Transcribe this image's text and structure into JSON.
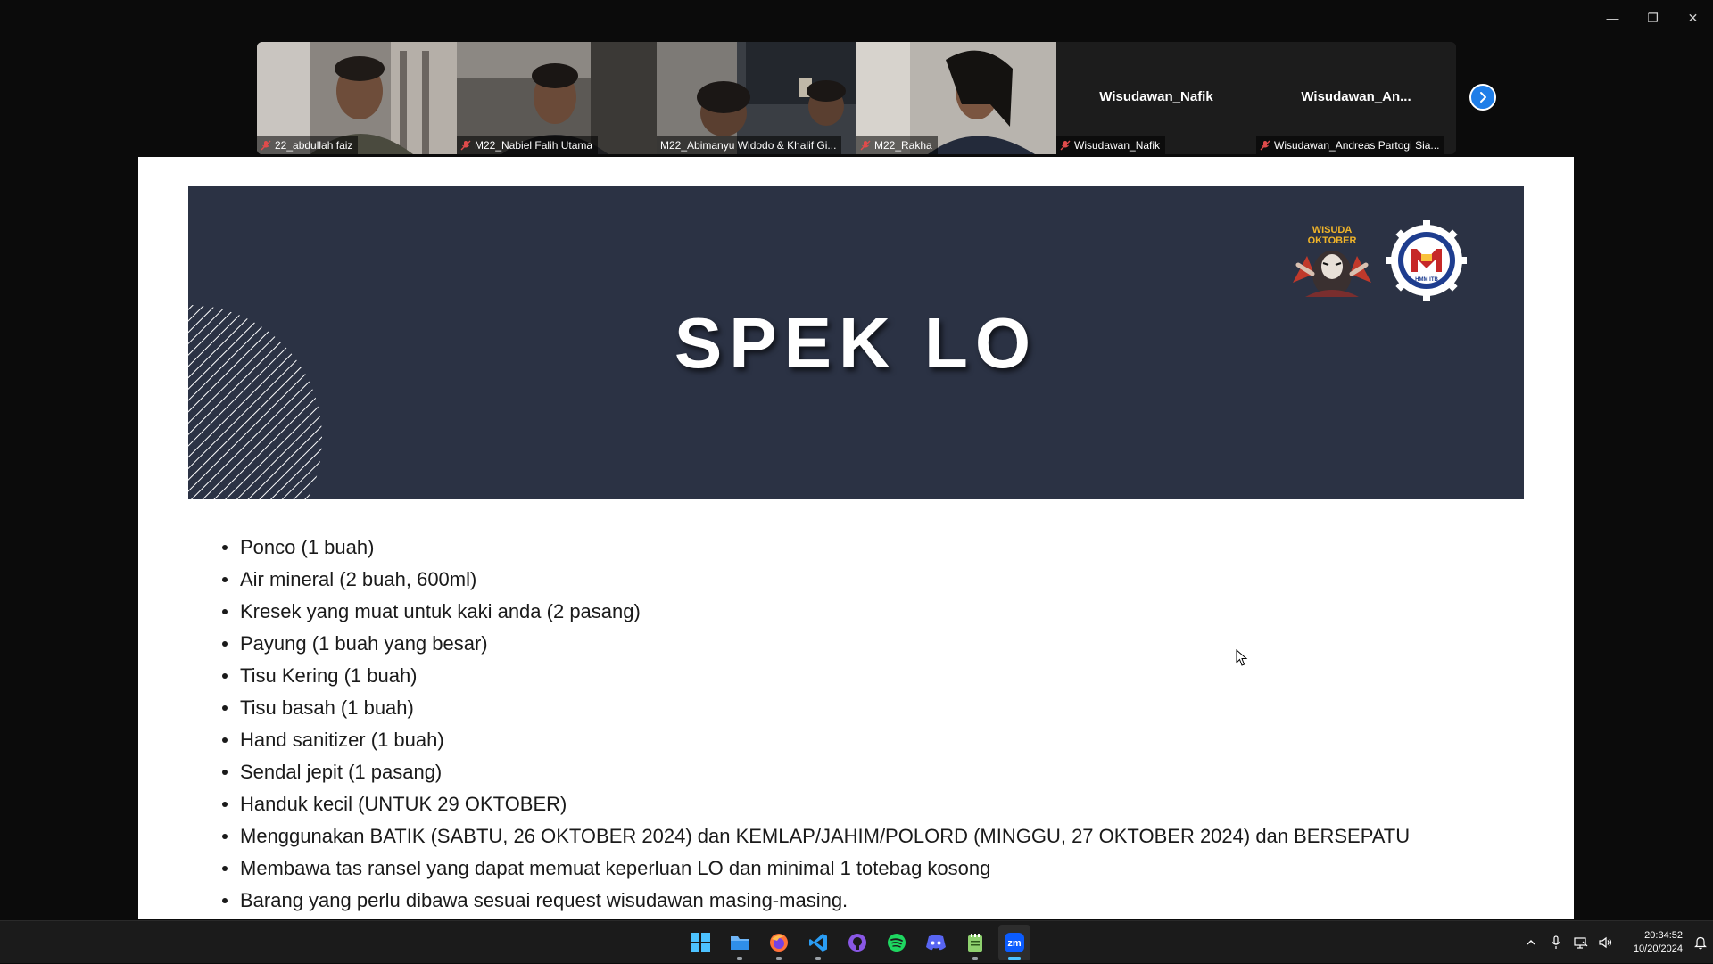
{
  "window": {
    "minimize_glyph": "—",
    "maximize_glyph": "❐",
    "close_glyph": "✕"
  },
  "gallery": {
    "tiles": [
      {
        "name": "22_abdullah faiz",
        "muted": true,
        "video": true
      },
      {
        "name": "M22_Nabiel Falih Utama",
        "muted": true,
        "video": true
      },
      {
        "name": "M22_Abimanyu Widodo & Khalif Gi...",
        "muted": false,
        "video": true,
        "active": true
      },
      {
        "name": "M22_Rakha",
        "muted": true,
        "video": true
      },
      {
        "name": "Wisudawan_Nafik",
        "center_name": "Wisudawan_Nafik",
        "muted": true,
        "video": false
      },
      {
        "name": "Wisudawan_Andreas Partogi Sia...",
        "center_name": "Wisudawan_An...",
        "muted": true,
        "video": false
      }
    ],
    "next_icon": "chevron-right-icon"
  },
  "slide": {
    "title": "SPEK LO",
    "logo_wisuda_text": "WISUDA OKTOBER",
    "logo_hmm_text": "HMM ITB",
    "items": [
      "Ponco (1 buah)",
      "Air mineral (2 buah, 600ml)",
      "Kresek yang muat untuk kaki anda (2 pasang)",
      "Payung (1 buah yang besar)",
      "Tisu Kering (1 buah)",
      "Tisu basah (1 buah)",
      "Hand sanitizer (1 buah)",
      "Sendal jepit (1 pasang)",
      "Handuk kecil (UNTUK 29 OKTOBER)",
      "Menggunakan BATIK (SABTU, 26 OKTOBER 2024) dan KEMLAP/JAHIM/POLORD (MINGGU, 27 OKTOBER 2024) dan BERSEPATU",
      "Membawa tas ransel yang dapat memuat keperluan LO dan minimal 1 totebag kosong",
      "Barang yang perlu dibawa sesuai request wisudawan masing-masing."
    ],
    "colors": {
      "banner": "#2b3244",
      "text": "#1a1a1a"
    }
  },
  "taskbar": {
    "apps": [
      {
        "icon": "windows-start-icon",
        "running": false,
        "focused": false
      },
      {
        "icon": "file-explorer-icon",
        "running": true,
        "focused": false
      },
      {
        "icon": "firefox-icon",
        "running": true,
        "focused": false
      },
      {
        "icon": "vscode-icon",
        "running": true,
        "focused": false
      },
      {
        "icon": "github-desktop-icon",
        "running": false,
        "focused": false
      },
      {
        "icon": "spotify-icon",
        "running": false,
        "focused": false
      },
      {
        "icon": "discord-icon",
        "running": false,
        "focused": false
      },
      {
        "icon": "notepad-icon",
        "running": true,
        "focused": false
      },
      {
        "icon": "zoom-icon",
        "running": true,
        "focused": true
      }
    ],
    "zoom_label": "zm",
    "clock": {
      "time": "20:34:52",
      "date": "10/20/2024"
    }
  }
}
